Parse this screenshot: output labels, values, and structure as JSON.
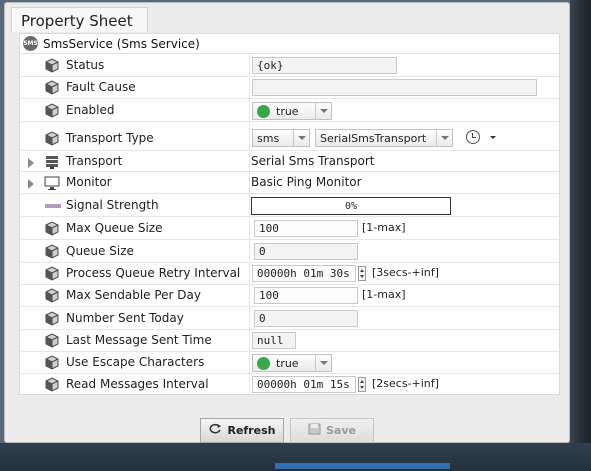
{
  "window": {
    "title": "Property Sheet"
  },
  "header": {
    "icon_text": "SMS",
    "text": "SmsService  (Sms Service)"
  },
  "rows": [
    {
      "label": "Status",
      "value": "{ok}"
    },
    {
      "label": "Fault Cause",
      "value": ""
    },
    {
      "label": "Enabled",
      "value": "true"
    },
    {
      "label": "Transport Type",
      "value_type": "sms",
      "value_class": "SerialSmsTransport"
    },
    {
      "label": "Transport",
      "value": "Serial Sms Transport"
    },
    {
      "label": "Monitor",
      "value": "Basic Ping Monitor"
    },
    {
      "label": "Signal Strength",
      "value": "0%",
      "level": 0
    },
    {
      "label": "Max Queue Size",
      "value": "100",
      "range": "[1-max]"
    },
    {
      "label": "Queue Size",
      "value": "0"
    },
    {
      "label": "Process Queue Retry Interval",
      "value": "00000h 01m 30s",
      "range": "[3secs-+inf]"
    },
    {
      "label": "Max Sendable Per Day",
      "value": "100",
      "range": "[1-max]"
    },
    {
      "label": "Number Sent Today",
      "value": "0"
    },
    {
      "label": "Last Message Sent Time",
      "value": "null"
    },
    {
      "label": "Use Escape Characters",
      "value": "true"
    },
    {
      "label": "Read Messages Interval",
      "value": "00000h 01m 15s",
      "range": "[2secs-+inf]"
    }
  ],
  "buttons": {
    "refresh": "Refresh",
    "save": "Save"
  },
  "colors": {
    "enabled_dot": "#3aa64b",
    "signal_icon": "#b29ac6"
  }
}
